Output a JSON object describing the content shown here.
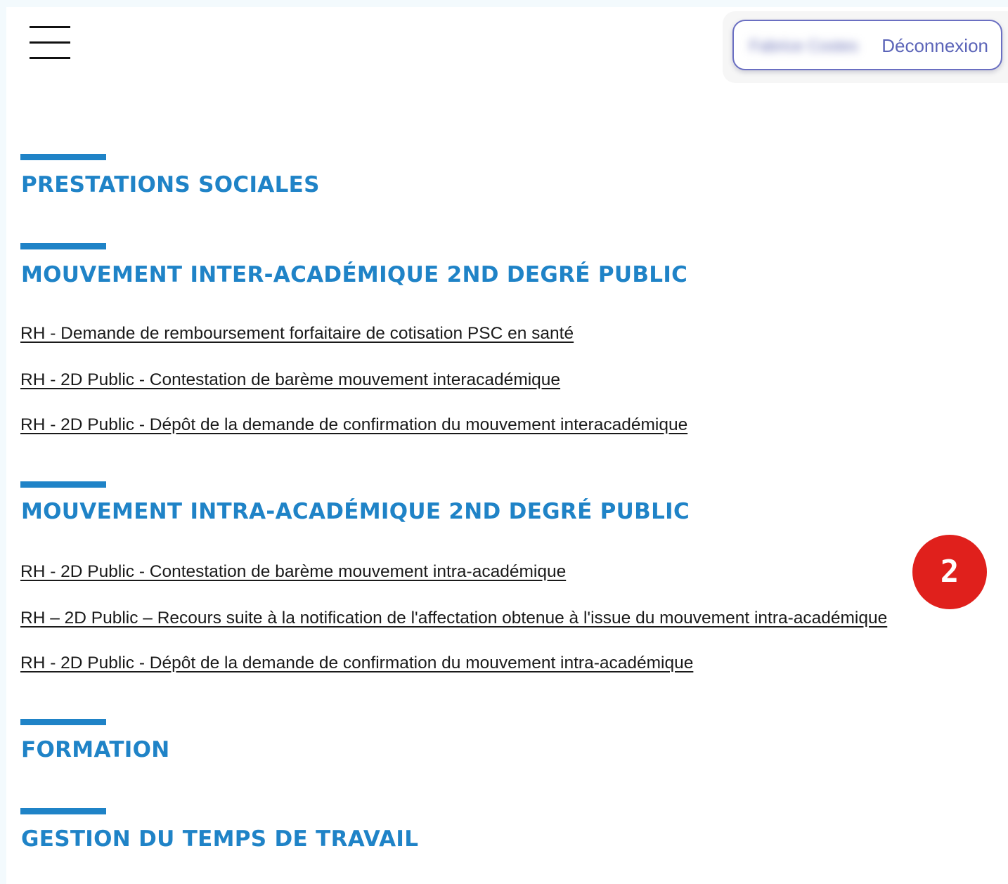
{
  "header": {
    "menu_icon": "hamburger-icon",
    "user_name": "Fabrice Costes",
    "logout_label": "Déconnexion"
  },
  "sections": [
    {
      "title": "PRESTATIONS SOCIALES",
      "links": []
    },
    {
      "title": "MOUVEMENT INTER-ACADÉMIQUE 2ND DEGRÉ PUBLIC",
      "links": [
        "RH - Demande de remboursement forfaitaire de cotisation PSC en santé",
        "RH - 2D Public - Contestation de barème mouvement interacadémique",
        "RH - 2D Public - Dépôt de la demande de confirmation du mouvement interacadémique"
      ]
    },
    {
      "title": "MOUVEMENT INTRA-ACADÉMIQUE 2ND DEGRÉ PUBLIC",
      "links": [
        "RH - 2D Public - Contestation de barème mouvement intra-académique",
        "RH – 2D Public – Recours suite à la notification de l'affectation obtenue à l'issue du mouvement intra-académique",
        "RH - 2D Public - Dépôt de la demande de confirmation du mouvement intra-académique"
      ]
    },
    {
      "title": "FORMATION",
      "links": []
    },
    {
      "title": "GESTION DU TEMPS DE TRAVAIL",
      "links": []
    }
  ],
  "annotation": {
    "step_number": "2"
  },
  "colors": {
    "accent": "#1f83c7",
    "badge": "#e0201c",
    "logout_border": "#6a6fc2"
  }
}
